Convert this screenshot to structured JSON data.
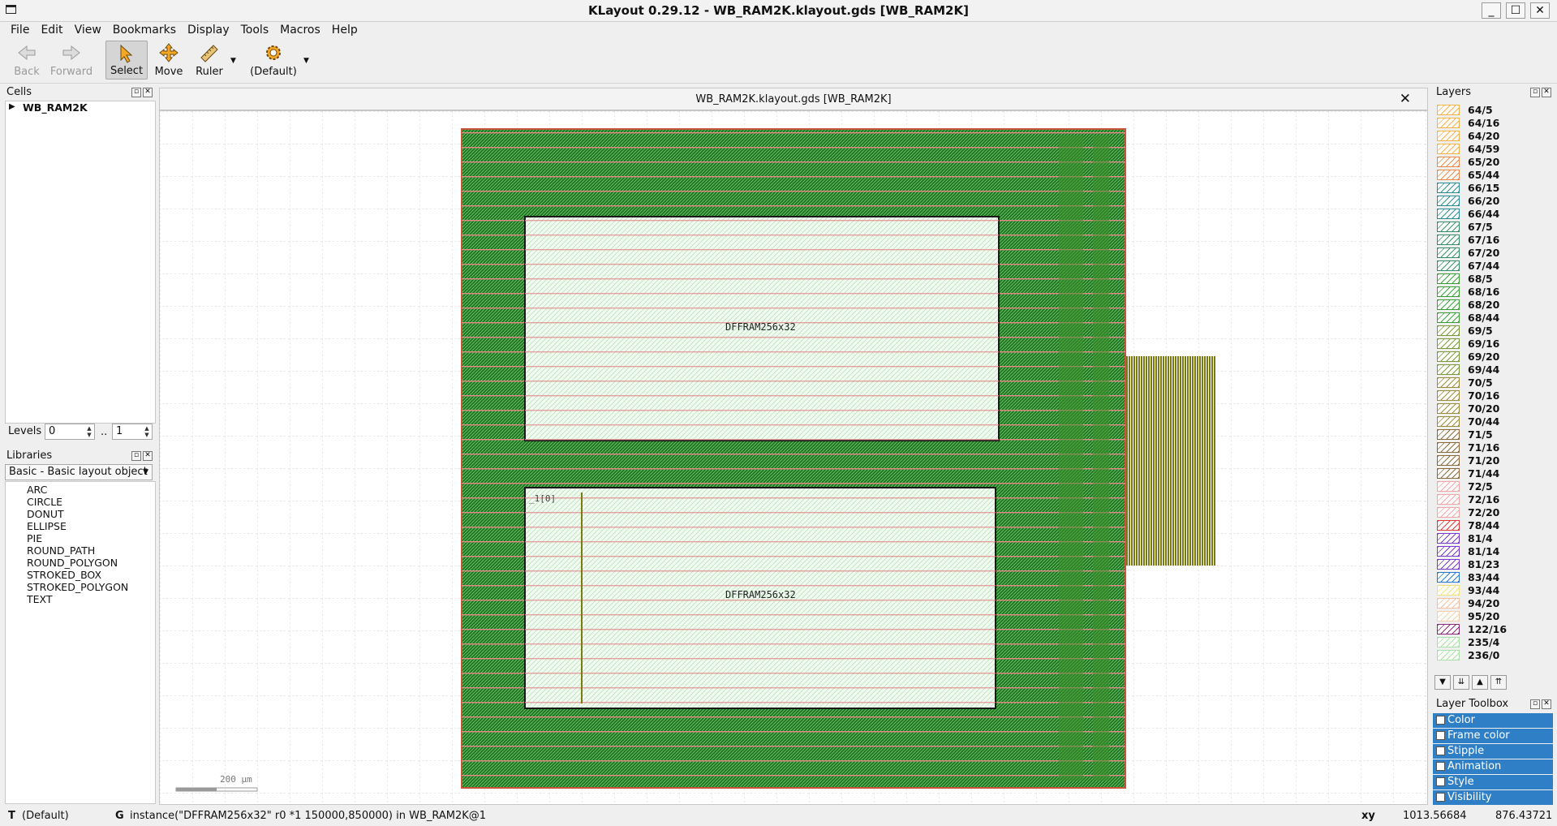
{
  "window": {
    "title": "KLayout 0.29.12 - WB_RAM2K.klayout.gds [WB_RAM2K]"
  },
  "menu": [
    "File",
    "Edit",
    "View",
    "Bookmarks",
    "Display",
    "Tools",
    "Macros",
    "Help"
  ],
  "toolbar": {
    "back": "Back",
    "forward": "Forward",
    "select": "Select",
    "move": "Move",
    "ruler": "Ruler",
    "default": "(Default)"
  },
  "cells": {
    "title": "Cells",
    "root": "WB_RAM2K"
  },
  "levels": {
    "label": "Levels",
    "from": "0",
    "sep": "..",
    "to": "1"
  },
  "libraries": {
    "title": "Libraries",
    "selected": "Basic - Basic layout object",
    "items": [
      "ARC",
      "CIRCLE",
      "DONUT",
      "ELLIPSE",
      "PIE",
      "ROUND_PATH",
      "ROUND_POLYGON",
      "STROKED_BOX",
      "STROKED_POLYGON",
      "TEXT"
    ]
  },
  "document": {
    "tab": "WB_RAM2K.klayout.gds [WB_RAM2K]",
    "instance_label_1": "DFFRAM256x32",
    "instance_label_2": "DFFRAM256x32",
    "instance_label_3": "_1[0]",
    "scale_label": "200 µm"
  },
  "layers": {
    "title": "Layers",
    "items": [
      {
        "name": "64/5",
        "color": "#f7b24a"
      },
      {
        "name": "64/16",
        "color": "#f7b24a"
      },
      {
        "name": "64/20",
        "color": "#f7b24a"
      },
      {
        "name": "64/59",
        "color": "#f7b24a"
      },
      {
        "name": "65/20",
        "color": "#f08a4b"
      },
      {
        "name": "65/44",
        "color": "#f08a4b"
      },
      {
        "name": "66/15",
        "color": "#2c8f96"
      },
      {
        "name": "66/20",
        "color": "#2c8f96"
      },
      {
        "name": "66/44",
        "color": "#2c8f96"
      },
      {
        "name": "67/5",
        "color": "#3a8f6a"
      },
      {
        "name": "67/16",
        "color": "#3a8f6a"
      },
      {
        "name": "67/20",
        "color": "#3a8f6a"
      },
      {
        "name": "67/44",
        "color": "#3a8f6a"
      },
      {
        "name": "68/5",
        "color": "#3aa03a"
      },
      {
        "name": "68/16",
        "color": "#3aa03a"
      },
      {
        "name": "68/20",
        "color": "#3aa03a"
      },
      {
        "name": "68/44",
        "color": "#3aa03a"
      },
      {
        "name": "69/5",
        "color": "#7a9a3a"
      },
      {
        "name": "69/16",
        "color": "#7a9a3a"
      },
      {
        "name": "69/20",
        "color": "#7a9a3a"
      },
      {
        "name": "69/44",
        "color": "#7a9a3a"
      },
      {
        "name": "70/5",
        "color": "#9a8a3a"
      },
      {
        "name": "70/16",
        "color": "#9a8a3a"
      },
      {
        "name": "70/20",
        "color": "#9a8a3a"
      },
      {
        "name": "70/44",
        "color": "#9a8a3a"
      },
      {
        "name": "71/5",
        "color": "#8a6a3a"
      },
      {
        "name": "71/16",
        "color": "#8a6a3a"
      },
      {
        "name": "71/20",
        "color": "#8a6a3a"
      },
      {
        "name": "71/44",
        "color": "#8a6a3a"
      },
      {
        "name": "72/5",
        "color": "#f4a6a6"
      },
      {
        "name": "72/16",
        "color": "#f4a6a6"
      },
      {
        "name": "72/20",
        "color": "#f4a6a6"
      },
      {
        "name": "78/44",
        "color": "#e03a3a"
      },
      {
        "name": "81/4",
        "color": "#7a3ad0"
      },
      {
        "name": "81/14",
        "color": "#7a3ad0"
      },
      {
        "name": "81/23",
        "color": "#7a3ad0"
      },
      {
        "name": "83/44",
        "color": "#2a7ad0"
      },
      {
        "name": "93/44",
        "color": "#f4e07a"
      },
      {
        "name": "94/20",
        "color": "#f4c0a0"
      },
      {
        "name": "95/20",
        "color": "#f4d0b0"
      },
      {
        "name": "122/16",
        "color": "#8a2a7a"
      },
      {
        "name": "235/4",
        "color": "#a8e0a8"
      },
      {
        "name": "236/0",
        "color": "#a8e0a8"
      }
    ]
  },
  "layer_toolbox": {
    "title": "Layer Toolbox",
    "items": [
      "Color",
      "Frame color",
      "Stipple",
      "Animation",
      "Style",
      "Visibility"
    ]
  },
  "status": {
    "mode_key": "T",
    "mode": "(Default)",
    "g_key": "G",
    "message": "instance(\"DFFRAM256x32\" r0 *1 150000,850000) in WB_RAM2K@1",
    "coord_label": "xy",
    "x": "1013.56684",
    "y": "876.43721"
  }
}
